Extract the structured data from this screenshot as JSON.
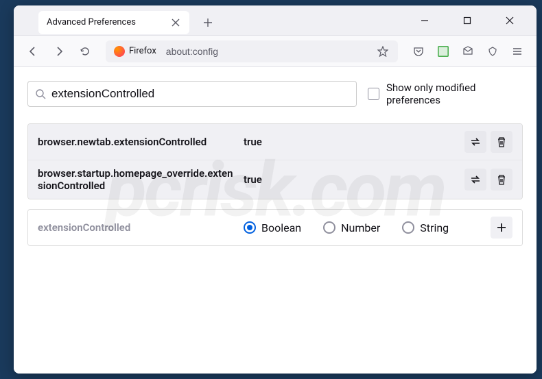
{
  "window": {
    "tab_title": "Advanced Preferences"
  },
  "urlbar": {
    "identity": "Firefox",
    "url": "about:config"
  },
  "search": {
    "value": "extensionControlled",
    "filter_label": "Show only modified preferences"
  },
  "prefs": [
    {
      "name": "browser.newtab.extensionControlled",
      "value": "true"
    },
    {
      "name": "browser.startup.homepage_override.extensionControlled",
      "value": "true"
    }
  ],
  "new_pref": {
    "name": "extensionControlled",
    "types": {
      "boolean": "Boolean",
      "number": "Number",
      "string": "String"
    },
    "selected": "boolean"
  },
  "watermark": "pcrisk.com"
}
